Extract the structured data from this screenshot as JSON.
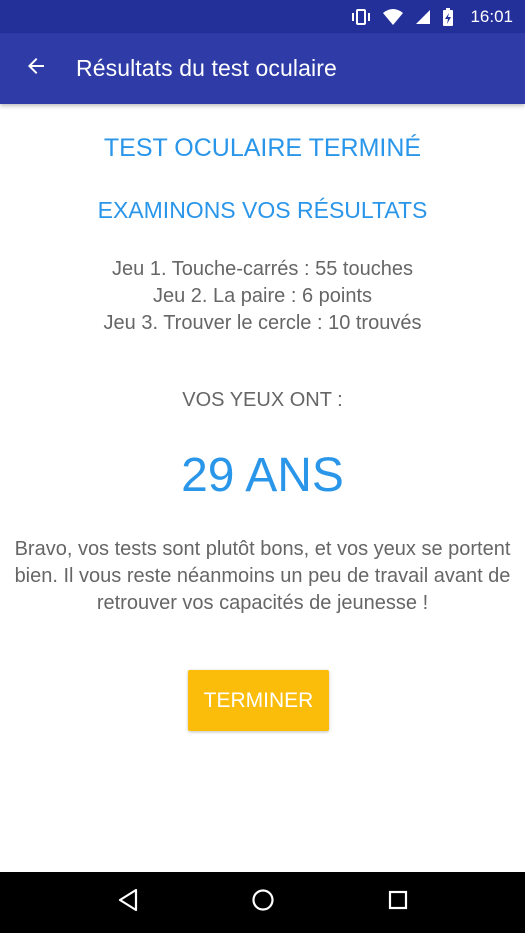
{
  "status_bar": {
    "time": "16:01",
    "icons": [
      "vibrate-icon",
      "wifi-icon",
      "signal-icon",
      "battery-charging-icon"
    ]
  },
  "app_bar": {
    "back_icon": "arrow-back-icon",
    "title": "Résultats du test oculaire"
  },
  "main": {
    "heading": "TEST OCULAIRE TERMINÉ",
    "subheading": "EXAMINONS VOS RÉSULTATS",
    "scores": [
      "Jeu 1. Touche-carrés : 55 touches",
      "Jeu 2. La paire : 6 points",
      "Jeu 3. Trouver le cercle : 10 trouvés"
    ],
    "eyes_label": "VOS YEUX ONT :",
    "age_value": "29 ANS",
    "message": "Bravo, vos tests sont plutôt bons, et vos yeux se portent bien. Il vous reste néanmoins un peu de travail avant de retrouver vos capacités de jeunesse !",
    "finish_button": "TERMINER"
  },
  "nav_bar": {
    "buttons": [
      "back-triangle-icon",
      "home-circle-icon",
      "recents-square-icon"
    ]
  },
  "colors": {
    "status_bar": "#24309a",
    "app_bar": "#2f3ca7",
    "accent_blue": "#2a96ea",
    "text_gray": "#666666",
    "button_yellow": "#fbbd0a"
  }
}
